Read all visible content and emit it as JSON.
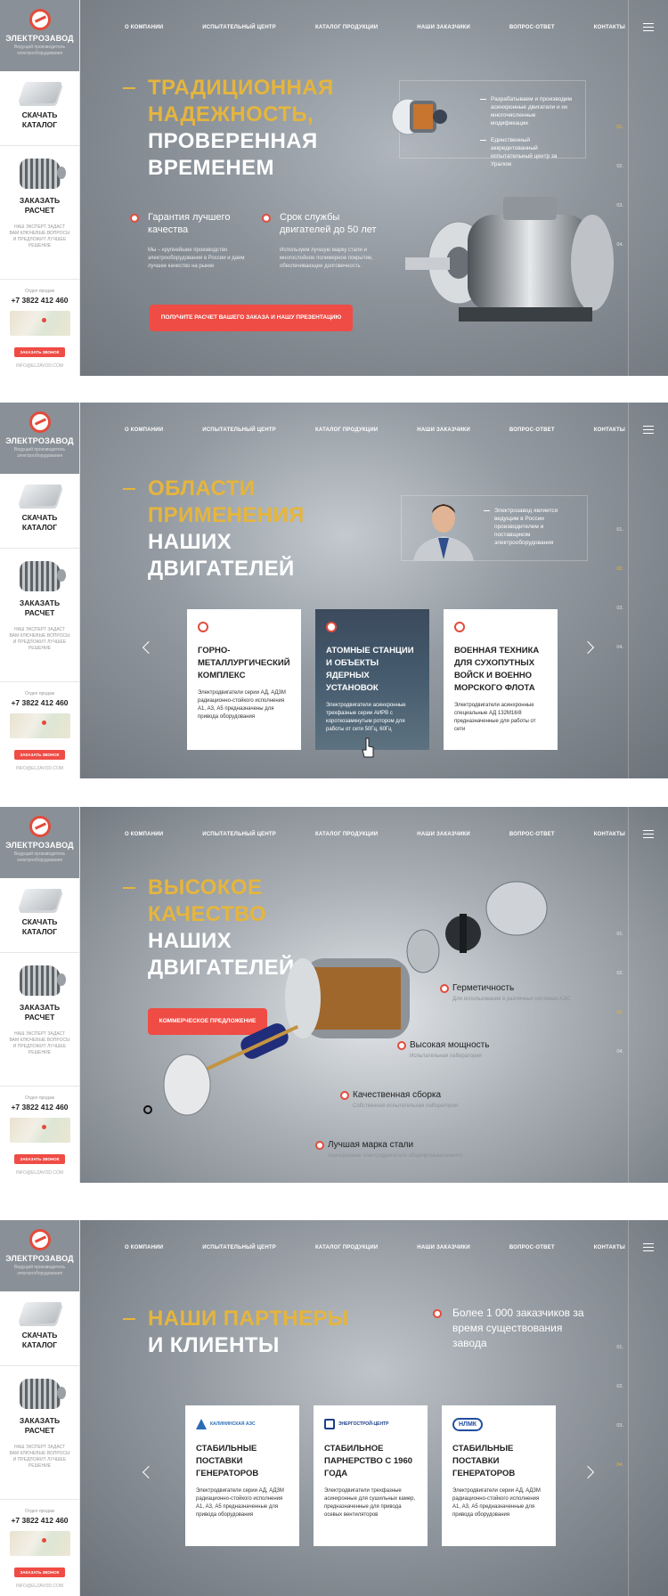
{
  "brand": {
    "name": "ЭЛЕКТРОЗАВОД",
    "tagline": "Ведущий производитель электрооборудования"
  },
  "nav": [
    "О КОМПАНИИ",
    "ИСПЫТАТЕЛЬНЫЙ ЦЕНТР",
    "КАТАЛОГ ПРОДУКЦИИ",
    "НАШИ ЗАКАЗЧИКИ",
    "ВОПРОС-ОТВЕТ",
    "КОНТАКТЫ"
  ],
  "sidebar": {
    "catalog": "СКАЧАТЬ КАТАЛОГ",
    "order": "ЗАКАЗАТЬ РАСЧЕТ",
    "order_note": "НАШ ЭКСПЕРТ ЗАДАСТ ВАМ КЛЮЧЕВЫЕ ВОПРОСЫ И ПРЕДЛОЖИТ ЛУЧШЕЕ РЕШЕНИЕ",
    "dept": "Отдел продаж",
    "phone": "+7 3822 412 460",
    "call_btn": "ЗАКАЗАТЬ ЗВОНОК",
    "site": "INFO@ELZAVOD.COM"
  },
  "steps": [
    "01.",
    "02.",
    "03.",
    "04."
  ],
  "s1": {
    "gold": "ТРАДИЦИОННАЯ НАДЕЖНОСТЬ,",
    "white": "ПРОВЕРЕННАЯ ВРЕМЕНЕМ",
    "f1_title": "Гарантия лучшего качества",
    "f1_text": "Мы – крупнейшее производство электрооборудования в России и даем лучшее качество на рынке",
    "f2_title": "Срок службы двигателей до 50 лет",
    "f2_text": "Используем лучшую марку стали и многослойное полимерное покрытие, обеспечивающее долговечность",
    "cta": "ПОЛУЧИТЕ РАСЧЕТ ВАШЕГО ЗАКАЗА И НАШУ ПРЕЗЕНТАЦИЮ",
    "info1": "Разрабатываем и производим асинхронные двигатели и их многочисленные модификации",
    "info2": "Единственный аккредитованный испытательный центр за Уралом"
  },
  "s2": {
    "gold": "ОБЛАСТИ ПРИМЕНЕНИЯ",
    "white": "НАШИХ ДВИГАТЕЛЕЙ",
    "info": "Электрозавод является ведущим в России производителем и поставщиком электрооборудования",
    "cards": [
      {
        "title": "ГОРНО-МЕТАЛЛУРГИЧЕСКИЙ КОМПЛЕКС",
        "text": "Электродвигатели серии АД, АД3М радиационно-стойкого исполнения А1, А3, А5 предназначены для привода оборудования"
      },
      {
        "title": "АТОМНЫЕ СТАНЦИИ И ОБЪЕКТЫ ЯДЕРНЫХ УСТАНОВОК",
        "text": "Электродвигатели асинхронные трехфазные серии АИРВ с короткозамкнутым ротором для работы от сети 50Гц, 60Гц"
      },
      {
        "title": "ВОЕННАЯ ТЕХНИКА ДЛЯ СУХОПУТНЫХ ВОЙСК И ВОЕННО МОРСКОГО ФЛОТА",
        "text": "Электродвигатели асинхронные специальные АД 132М16/8 предназначенные для работы от сети"
      }
    ]
  },
  "s3": {
    "gold": "ВЫСОКОЕ КАЧЕСТВО",
    "white": "НАШИХ ДВИГАТЕЛЕЙ",
    "cta": "КОММЕРЧЕСКОЕ ПРЕДЛОЖЕНИЕ",
    "callouts": [
      {
        "title": "Герметичность",
        "text": "Для использования в различных системах АЭС"
      },
      {
        "title": "Высокая мощность",
        "text": "Испытательная лаборатория"
      },
      {
        "title": "Качественная сборка",
        "text": "Собственная испытательная лаборатория"
      },
      {
        "title": "Лучшая марка стали",
        "text": "Асинхронные электродвигатели общепромышленного"
      }
    ]
  },
  "s4": {
    "gold": "НАШИ ПАРТНЕРЫ",
    "white": "И КЛИЕНТЫ",
    "stat": "Более 1 000 заказчиков за время существования завода",
    "cards": [
      {
        "logo": "КАЛИНИНСКАЯ АЭС",
        "title": "СТАБИЛЬНЫЕ ПОСТАВКИ ГЕНЕРАТОРОВ",
        "text": "Электродвигатели серии АД, АД3М радиационно-стойкого исполнения А1, А3, А5 предназначенные для привода оборудования"
      },
      {
        "logo": "ЭНЕРГОСТРОЙ-ЦЕНТР",
        "title": "СТАБИЛЬНОЕ ПАРНЕРСТВО С 1960 ГОДА",
        "text": "Электродвигатели трехфазные асинхронные для сушильных камер, предназначенные для привода осевых вентиляторов"
      },
      {
        "logo": "НЛМК",
        "title": "СТАБИЛЬНЫЕ ПОСТАВКИ ГЕНЕРАТОРОВ",
        "text": "Электродвигатели серии АД, АД3М радиационно-стойкого исполнения А1, А3, А5 предназначенные для привода оборудования"
      }
    ]
  },
  "colors": {
    "accent": "#ef4c45",
    "gold": "#e5b53d"
  },
  "icons": [
    "logo-icon",
    "catalog-icon",
    "motor-icon",
    "menu-icon",
    "arrow-left-icon",
    "arrow-right-icon",
    "cursor-icon"
  ]
}
